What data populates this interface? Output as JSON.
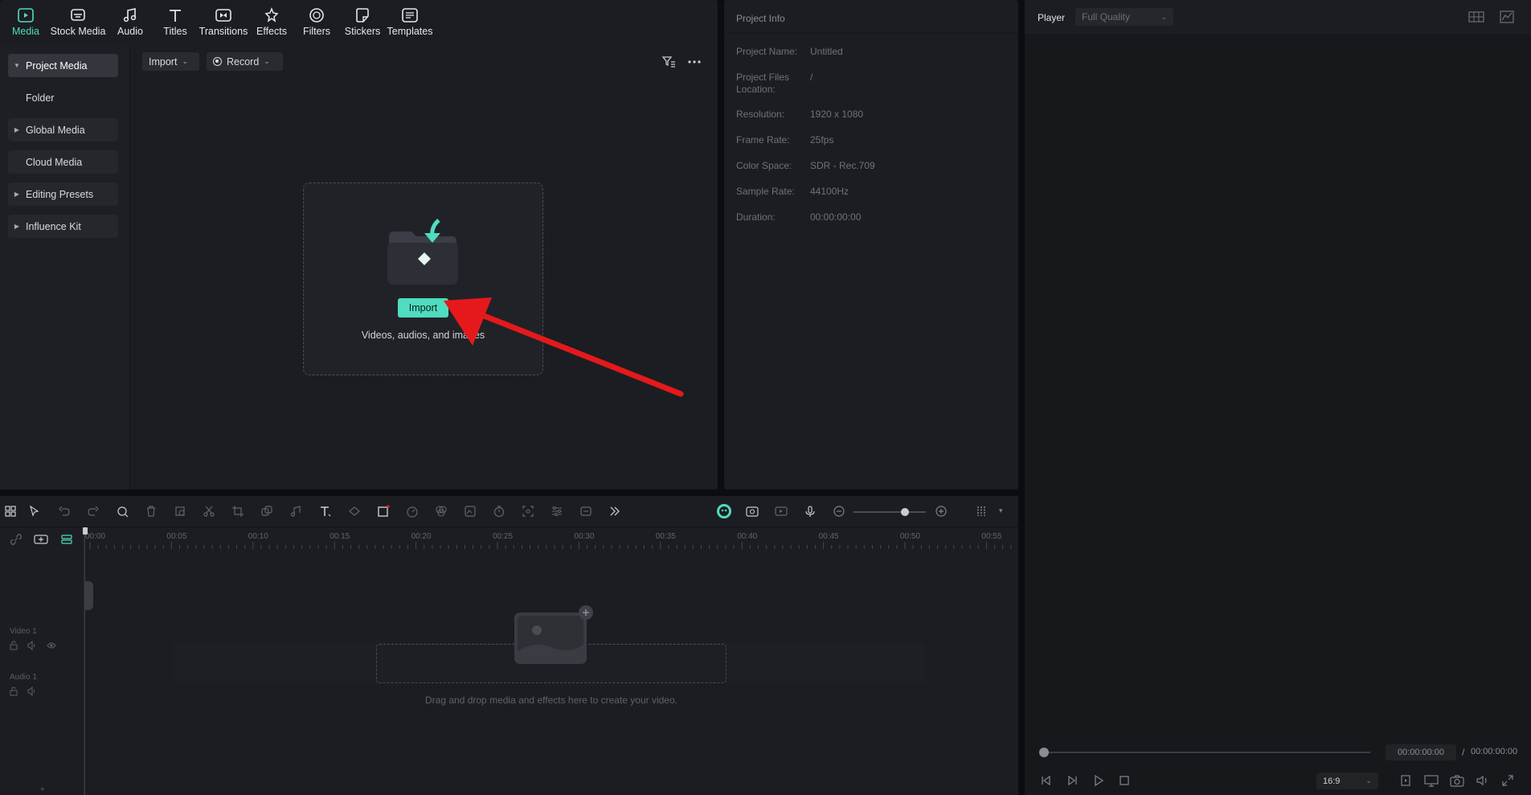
{
  "tabs": [
    {
      "label": "Media",
      "icon": "media-icon",
      "active": true
    },
    {
      "label": "Stock Media",
      "icon": "stock-media-icon"
    },
    {
      "label": "Audio",
      "icon": "audio-icon"
    },
    {
      "label": "Titles",
      "icon": "titles-icon"
    },
    {
      "label": "Transitions",
      "icon": "transitions-icon"
    },
    {
      "label": "Effects",
      "icon": "effects-icon"
    },
    {
      "label": "Filters",
      "icon": "filters-icon"
    },
    {
      "label": "Stickers",
      "icon": "stickers-icon"
    },
    {
      "label": "Templates",
      "icon": "templates-icon"
    }
  ],
  "sidebar": {
    "items": [
      {
        "label": "Project Media",
        "expandable": true,
        "active": true
      },
      {
        "label": "Folder",
        "expandable": false
      },
      {
        "label": "Global Media",
        "expandable": true
      },
      {
        "label": "Cloud Media",
        "expandable": false
      },
      {
        "label": "Editing Presets",
        "expandable": true
      },
      {
        "label": "Influence Kit",
        "expandable": true
      }
    ]
  },
  "media_toolbar": {
    "import_label": "Import",
    "record_label": "Record"
  },
  "drop_zone": {
    "button_label": "Import",
    "hint": "Videos, audios, and images"
  },
  "project_info": {
    "title": "Project Info",
    "rows": [
      {
        "label": "Project Name:",
        "value": "Untitled"
      },
      {
        "label": "Project Files Location:",
        "value": "/"
      },
      {
        "label": "Resolution:",
        "value": "1920 x 1080"
      },
      {
        "label": "Frame Rate:",
        "value": "25fps"
      },
      {
        "label": "Color Space:",
        "value": "SDR - Rec.709"
      },
      {
        "label": "Sample Rate:",
        "value": "44100Hz"
      },
      {
        "label": "Duration:",
        "value": "00:00:00:00"
      }
    ]
  },
  "player": {
    "title": "Player",
    "quality": "Full Quality",
    "current_time": "00:00:00:00",
    "separator": "/",
    "total_time": "00:00:00:00",
    "aspect_ratio": "16:9"
  },
  "timeline": {
    "ruler_labels": [
      "00:00",
      "00:05",
      "00:10",
      "00:15",
      "00:20",
      "00:25",
      "00:30",
      "00:35",
      "00:40",
      "00:45",
      "00:50",
      "00:55"
    ],
    "tracks": [
      {
        "label": "Video 1"
      },
      {
        "label": "Audio 1"
      }
    ],
    "drop_hint": "Drag and drop media and effects here to create your video.",
    "zoom_level": 0.71
  },
  "colors": {
    "accent": "#4fdcbf",
    "annotation_arrow": "#e5191c",
    "panel_bg": "#1c1d22"
  }
}
